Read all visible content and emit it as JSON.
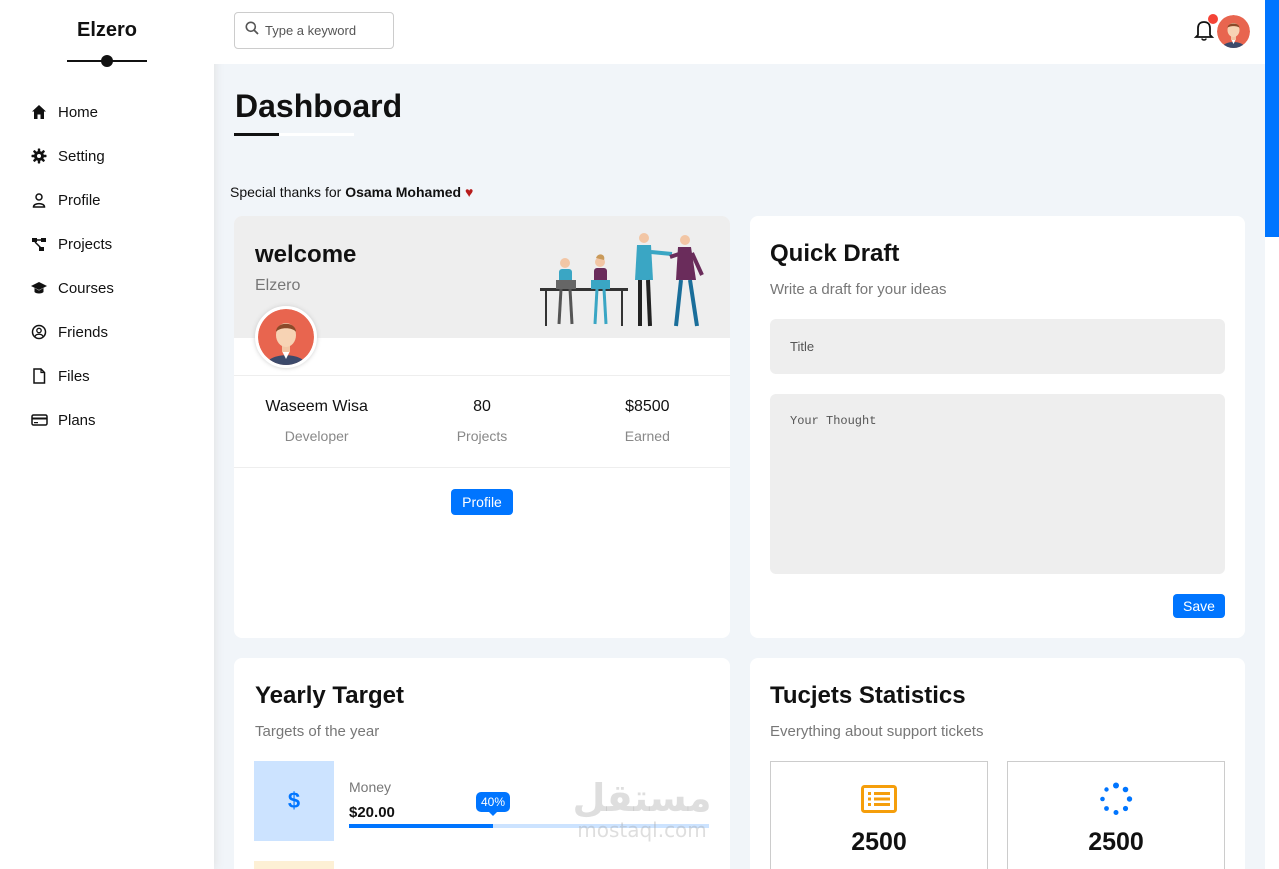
{
  "sidebar": {
    "brand": "Elzero",
    "items": [
      {
        "label": "Home",
        "icon": "home-icon"
      },
      {
        "label": "Setting",
        "icon": "gear-icon"
      },
      {
        "label": "Profile",
        "icon": "user-icon"
      },
      {
        "label": "Projects",
        "icon": "diagram-icon"
      },
      {
        "label": "Courses",
        "icon": "graduation-cap-icon"
      },
      {
        "label": "Friends",
        "icon": "user-circle-icon"
      },
      {
        "label": "Files",
        "icon": "file-icon"
      },
      {
        "label": "Plans",
        "icon": "credit-card-icon"
      }
    ]
  },
  "header": {
    "search_placeholder": "Type a keyword"
  },
  "page": {
    "title": "Dashboard",
    "thanks_prefix": "Special thanks for",
    "thanks_name": "Osama Mohamed"
  },
  "welcome": {
    "title": "welcome",
    "name": "Elzero",
    "stats": [
      {
        "value": "Waseem Wisa",
        "label": "Developer"
      },
      {
        "value": "80",
        "label": "Projects"
      },
      {
        "value": "$8500",
        "label": "Earned"
      }
    ],
    "button": "Profile"
  },
  "draft": {
    "title": "Quick Draft",
    "subtitle": "Write a draft for your ideas",
    "title_placeholder": "Title",
    "thought_placeholder": "Your Thought",
    "save": "Save"
  },
  "yearly": {
    "title": "Yearly Target",
    "subtitle": "Targets of the year",
    "targets": [
      {
        "label": "Money",
        "value": "$20.00",
        "progress_percent": 40,
        "progress_label": "40%",
        "color": "#0075ff"
      }
    ]
  },
  "tickets": {
    "title": "Tucjets Statistics",
    "subtitle": "Everything about support tickets",
    "boxes": [
      {
        "value": "2500",
        "icon": "list-icon",
        "color": "#f59e0b"
      },
      {
        "value": "2500",
        "icon": "spinner-icon",
        "color": "#0075ff"
      }
    ]
  },
  "watermark": {
    "arabic": "مستقل",
    "latin": "mostaql.com"
  },
  "colors": {
    "accent": "#0075ff",
    "notification": "#f44336",
    "heart": "#b71c1c"
  }
}
